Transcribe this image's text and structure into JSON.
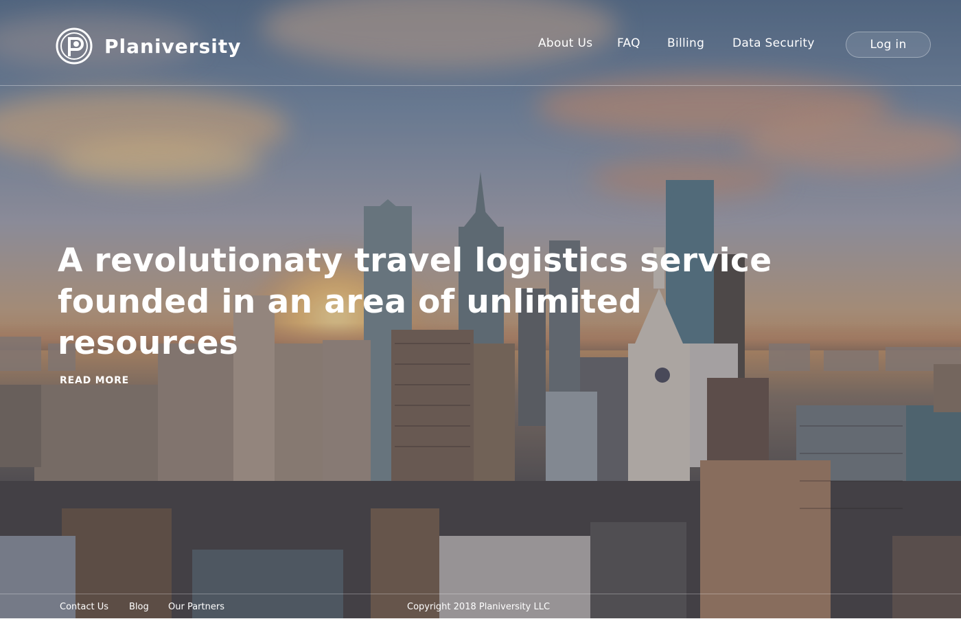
{
  "brand": {
    "name": "Planiversity",
    "logo_icon": "planiversity-logo-icon"
  },
  "nav": {
    "items": [
      {
        "label": "About Us"
      },
      {
        "label": "FAQ"
      },
      {
        "label": "Billing"
      },
      {
        "label": "Data Security"
      }
    ],
    "login_label": "Log in"
  },
  "hero": {
    "title_line1": "A revolutionaty travel logistics service",
    "title_line2": "founded in an area of unlimited resources",
    "read_more": "READ MORE"
  },
  "footer": {
    "links": [
      {
        "label": "Contact Us"
      },
      {
        "label": "Blog"
      },
      {
        "label": "Our Partners"
      }
    ],
    "copyright": "Copyright 2018 Planiversity LLC"
  },
  "colors": {
    "text": "#ffffff",
    "overlay": "#1e1e2d"
  }
}
